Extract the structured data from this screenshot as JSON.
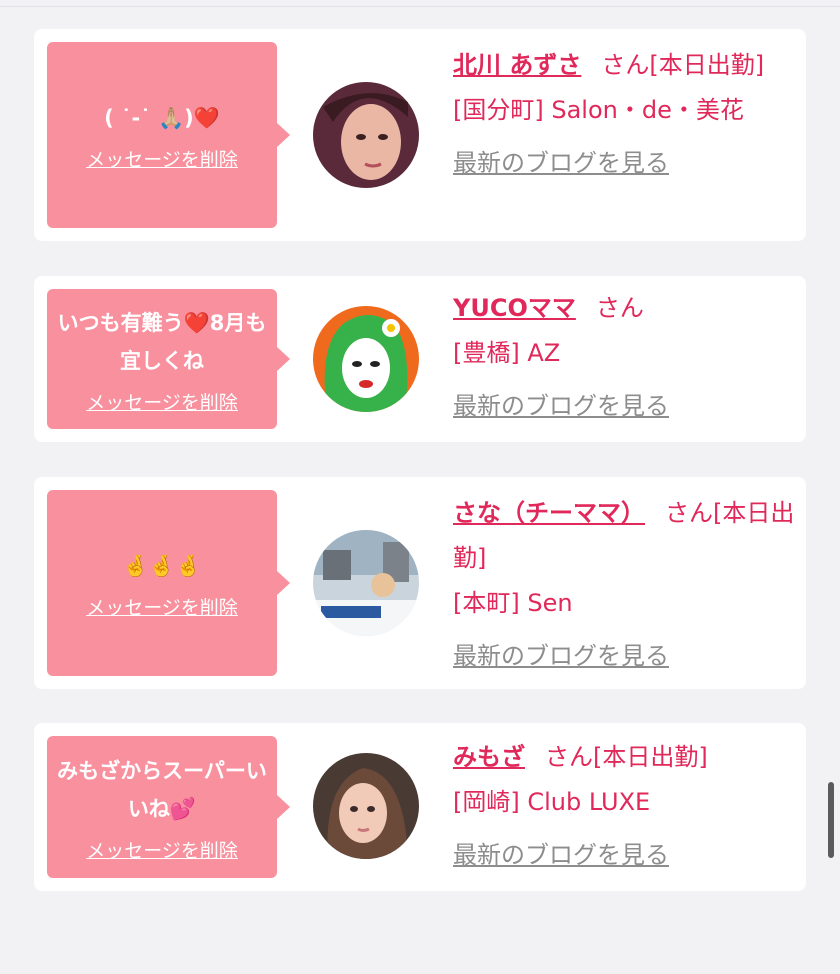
{
  "cards": [
    {
      "message": "( ˙-˙ 🙏🏼)❤️",
      "delete_label": "メッセージを削除",
      "name": "北川 あずさ",
      "san": "さん",
      "status": "[本日出勤]",
      "shop": "[国分町] Salon・de・美花",
      "blog_label": "最新のブログを見る"
    },
    {
      "message": "いつも有難う❤️8月も宜しくね",
      "delete_label": "メッセージを削除",
      "name": "YUCOママ",
      "san": "さん",
      "status": "",
      "shop": "[豊橋] AZ",
      "blog_label": "最新のブログを見る"
    },
    {
      "message": "🤞🤞🤞",
      "delete_label": "メッセージを削除",
      "name": "さな（チーママ）",
      "san": "さん",
      "status": "[本日出勤]",
      "shop": "[本町] Sen",
      "blog_label": "最新のブログを見る"
    },
    {
      "message": "みもざからスーパーいいね💕",
      "delete_label": "メッセージを削除",
      "name": "みもざ",
      "san": "さん",
      "status": "[本日出勤]",
      "shop": "[岡崎] Club LUXE",
      "blog_label": "最新のブログを見る"
    }
  ],
  "colors": {
    "accent": "#e0295a",
    "bubble": "#f9909e",
    "background": "#f2f2f4",
    "muted_link": "#8d8d8d"
  }
}
